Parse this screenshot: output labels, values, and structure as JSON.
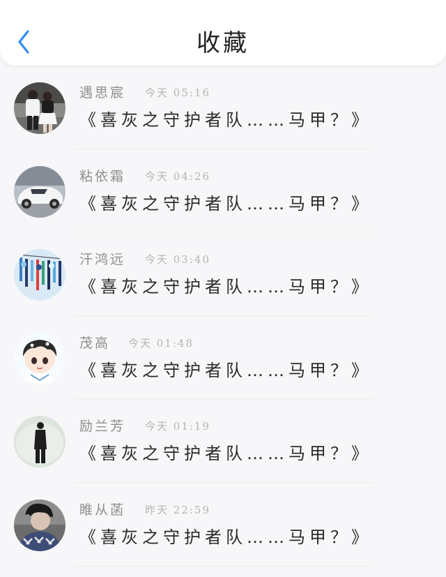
{
  "header": {
    "title": "收藏",
    "back_icon": "chevron-left-icon",
    "back_color": "#2e8ef2"
  },
  "messages": [
    {
      "name": "遇思宸",
      "time": "今天 05:16",
      "text": "《喜灰之守护者队……马甲？》",
      "avatar": "couple-photo"
    },
    {
      "name": "粘依霜",
      "time": "今天 04:26",
      "text": "《喜灰之守护者队……马甲？》",
      "avatar": "white-car"
    },
    {
      "name": "汗鸿远",
      "time": "今天 03:40",
      "text": "《喜灰之守护者队……马甲？》",
      "avatar": "colorful-wind-chimes"
    },
    {
      "name": "茂高",
      "time": "今天 01:48",
      "text": "《喜灰之守护者队……马甲？》",
      "avatar": "anime-boy"
    },
    {
      "name": "励兰芳",
      "time": "今天 01:19",
      "text": "《喜灰之守护者队……马甲？》",
      "avatar": "silhouette-person"
    },
    {
      "name": "睢从菡",
      "time": "昨天 22:59",
      "text": "《喜灰之守护者队……马甲？》",
      "avatar": "person-dark-photo"
    }
  ]
}
